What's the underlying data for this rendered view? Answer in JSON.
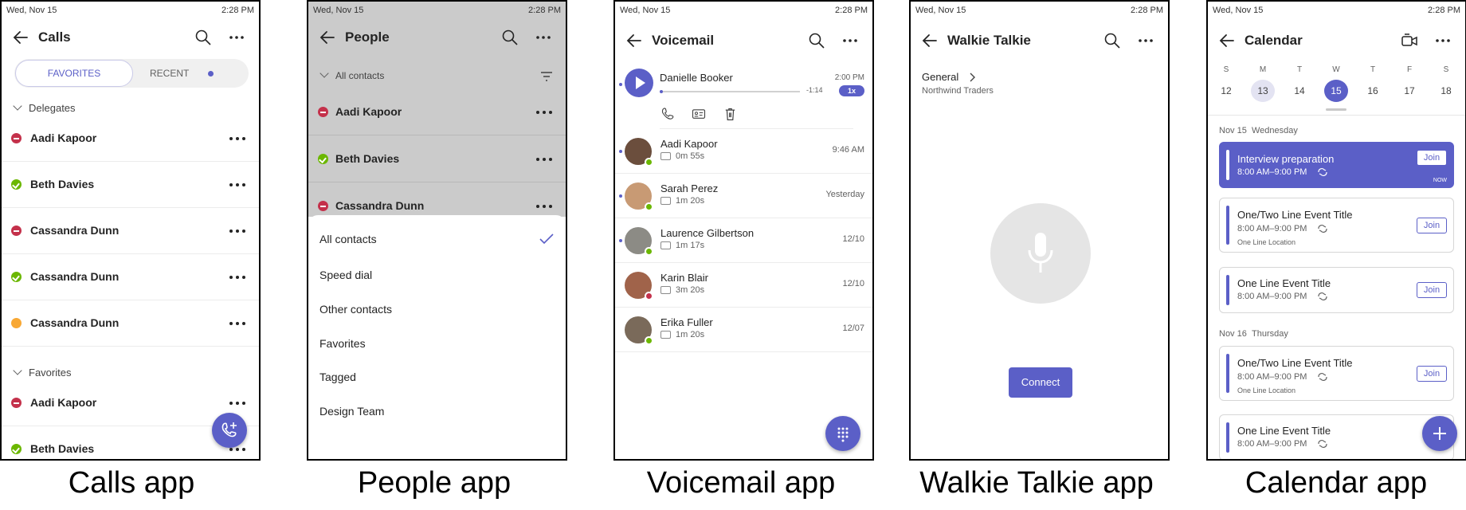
{
  "status": {
    "date": "Wed, Nov 15",
    "time": "2:28 PM"
  },
  "calls": {
    "title": "Calls",
    "caption": "Calls app",
    "tab_favorites": "FAVORITES",
    "tab_recent": "RECENT",
    "section_delegates": "Delegates",
    "section_favorites": "Favorites",
    "delegates": [
      {
        "name": "Aadi Kapoor",
        "status": "busy"
      },
      {
        "name": "Beth Davies",
        "status": "available"
      },
      {
        "name": "Cassandra Dunn",
        "status": "busy"
      },
      {
        "name": "Cassandra Dunn",
        "status": "available"
      },
      {
        "name": "Cassandra Dunn",
        "status": "away"
      }
    ],
    "favorites": [
      {
        "name": "Aadi Kapoor",
        "status": "busy"
      },
      {
        "name": "Beth Davies",
        "status": "available"
      }
    ]
  },
  "people": {
    "title": "People",
    "caption": "People app",
    "filter_label": "All contacts",
    "contacts": [
      {
        "name": "Aadi Kapoor",
        "status": "busy"
      },
      {
        "name": "Beth Davies",
        "status": "available"
      },
      {
        "name": "Cassandra Dunn",
        "status": "busy"
      }
    ],
    "options": [
      "All contacts",
      "Speed dial",
      "Other contacts",
      "Favorites",
      "Tagged",
      "Design Team"
    ],
    "selected_option": "All contacts"
  },
  "voicemail": {
    "title": "Voicemail",
    "caption": "Voicemail app",
    "playing": {
      "name": "Danielle Booker",
      "time": "2:00 PM",
      "remaining": "-1:14",
      "speed": "1x",
      "progress": 0.02
    },
    "items": [
      {
        "name": "Aadi Kapoor",
        "duration": "0m 55s",
        "time": "9:46 AM",
        "unread": true,
        "presence": "available"
      },
      {
        "name": "Sarah Perez",
        "duration": "1m 20s",
        "time": "Yesterday",
        "unread": true,
        "presence": "available"
      },
      {
        "name": "Laurence Gilbertson",
        "duration": "1m 17s",
        "time": "12/10",
        "unread": true,
        "presence": "available"
      },
      {
        "name": "Karin Blair",
        "duration": "3m 20s",
        "time": "12/10",
        "unread": false,
        "presence": "busy"
      },
      {
        "name": "Erika Fuller",
        "duration": "1m 20s",
        "time": "12/07",
        "unread": false,
        "presence": "available"
      }
    ]
  },
  "walkie": {
    "title": "Walkie Talkie",
    "caption": "Walkie Talkie app",
    "channel": "General",
    "team": "Northwind Traders",
    "connect_label": "Connect"
  },
  "calendar": {
    "title": "Calendar",
    "caption": "Calendar app",
    "weekdays": [
      "S",
      "M",
      "T",
      "W",
      "T",
      "F",
      "S"
    ],
    "days": [
      "12",
      "13",
      "14",
      "15",
      "16",
      "17",
      "18"
    ],
    "today_index": 3,
    "selected_index": 1,
    "day1_label": "Nov 15",
    "day1_weekday": "Wednesday",
    "day2_label": "Nov 16",
    "day2_weekday": "Thursday",
    "now_label": "NOW",
    "join_label": "Join",
    "events": [
      {
        "title": "Interview preparation",
        "time": "8:00 AM–9:00 PM",
        "location": ""
      },
      {
        "title": "One/Two Line Event Title",
        "time": "8:00 AM–9:00 PM",
        "location": "One Line Location"
      },
      {
        "title": "One Line Event Title",
        "time": "8:00 AM–9:00 PM",
        "location": ""
      },
      {
        "title": "One/Two Line Event Title",
        "time": "8:00 AM–9:00 PM",
        "location": "One Line Location"
      },
      {
        "title": "One Line Event Title",
        "time": "8:00 AM–9:00 PM",
        "location": ""
      }
    ]
  },
  "colors": {
    "accent": "#5b5fc7",
    "busy": "#c4314b",
    "available": "#6bb700",
    "away": "#f8a834"
  }
}
